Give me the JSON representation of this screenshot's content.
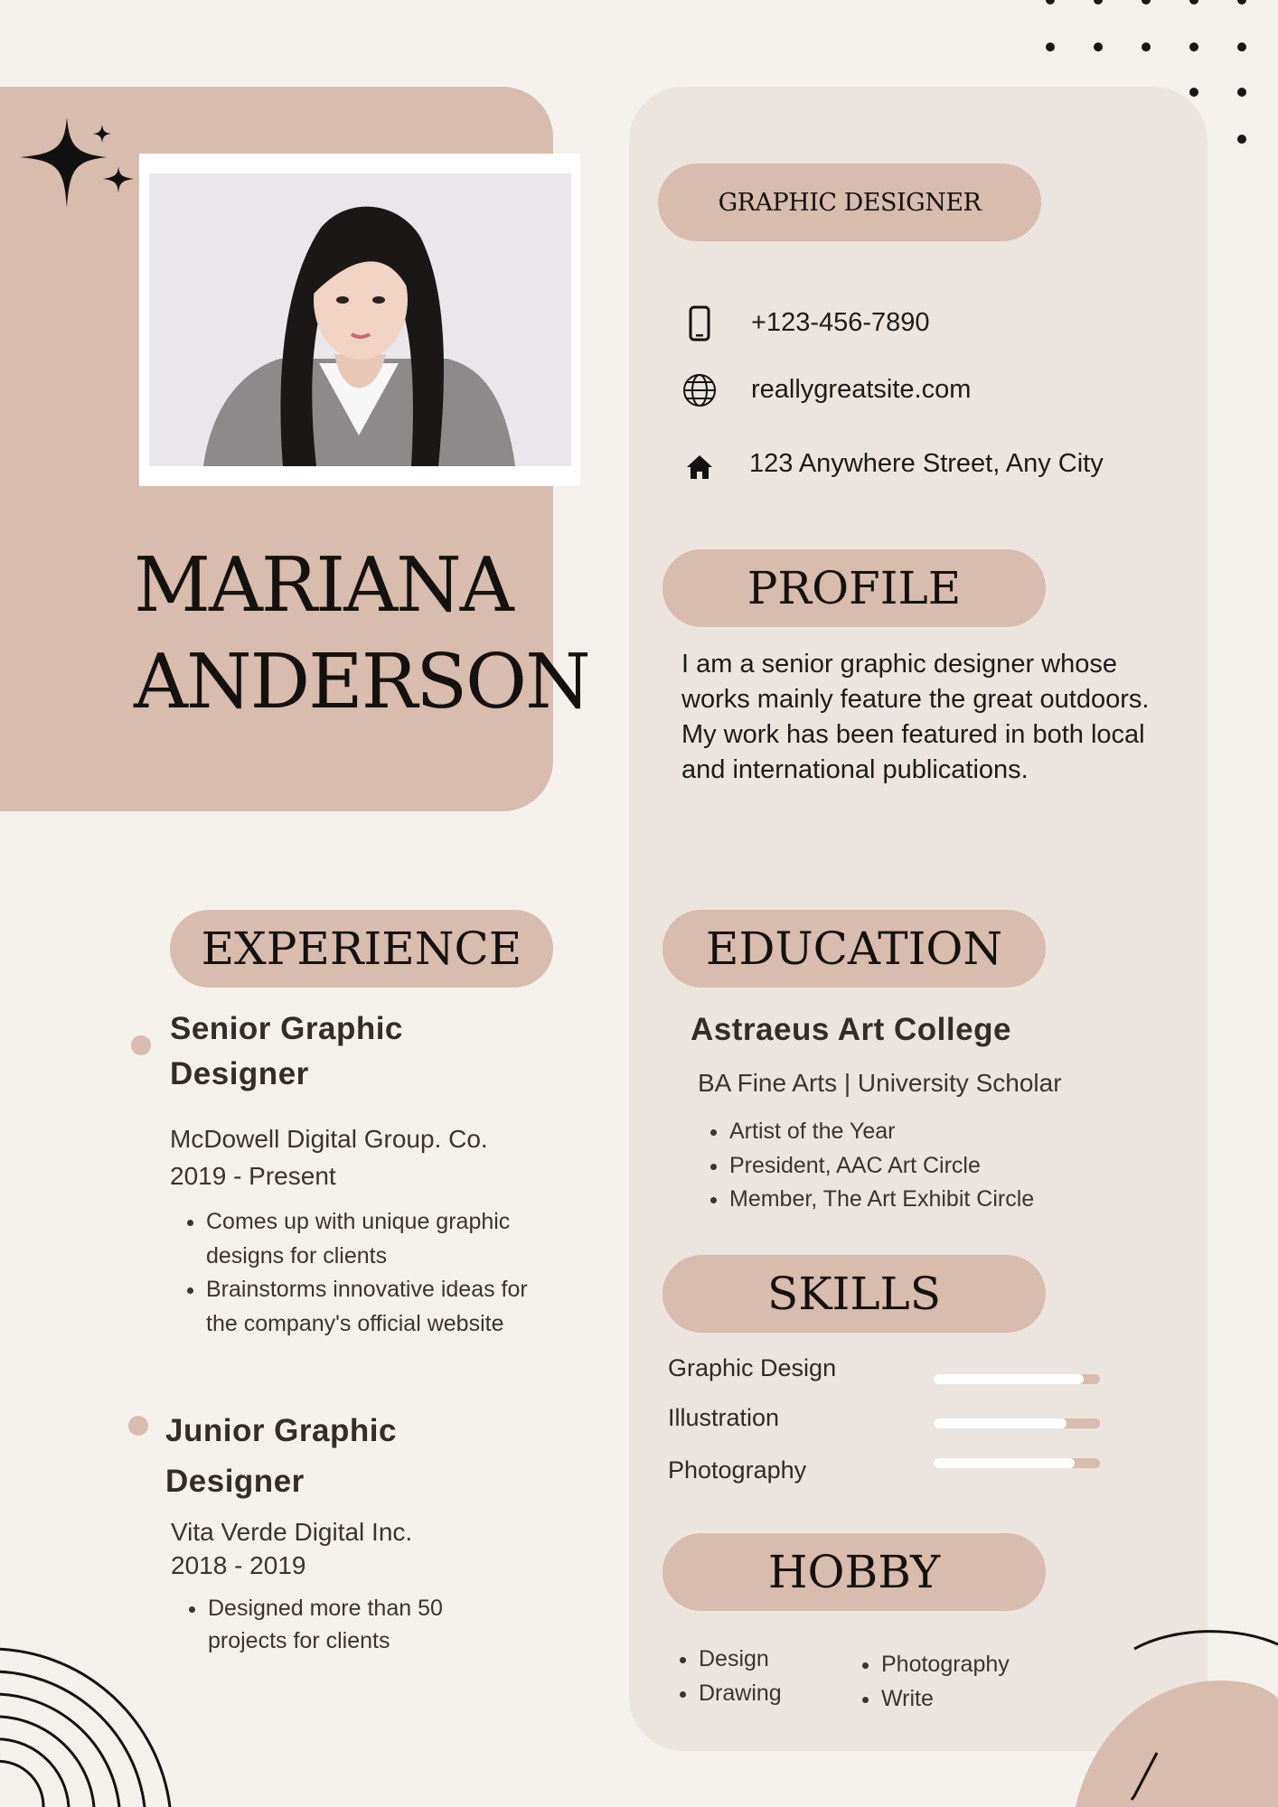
{
  "profile_header": {
    "first_name": "MARIANA",
    "last_name": "ANDERSON",
    "job_title": "GRAPHIC DESIGNER"
  },
  "contact": {
    "phone": "+123-456-7890",
    "website": "reallygreatsite.com",
    "address": "123 Anywhere Street, Any City"
  },
  "profile": {
    "heading": "PROFILE",
    "text": "I am a senior graphic designer whose works mainly feature the great outdoors. My work has been featured in both local and international publications."
  },
  "experience": {
    "heading": "EXPERIENCE",
    "jobs": [
      {
        "title": "Senior Graphic Designer",
        "company": "McDowell Digital Group. Co.",
        "period": "2019 - Present",
        "bullets": [
          "Comes up with unique graphic designs for clients",
          "Brainstorms innovative ideas for the company's official website"
        ]
      },
      {
        "title": "Junior Graphic Designer",
        "company": "Vita Verde Digital Inc.",
        "period": "2018 - 2019",
        "bullets": [
          "Designed more than 50 projects for clients"
        ]
      }
    ]
  },
  "education": {
    "heading": "EDUCATION",
    "school": "Astraeus Art College",
    "degree": "BA Fine Arts | University Scholar",
    "bullets": [
      "Artist of the Year",
      "President, AAC Art Circle",
      "Member, The Art Exhibit Circle"
    ]
  },
  "skills": {
    "heading": "SKILLS",
    "items": [
      {
        "name": "Graphic Design",
        "level": 0.9
      },
      {
        "name": "Illustration",
        "level": 0.8
      },
      {
        "name": "Photography",
        "level": 0.85
      }
    ]
  },
  "hobby": {
    "heading": "HOBBY",
    "col1": [
      "Design",
      "Drawing"
    ],
    "col2": [
      "Photography",
      "Write"
    ]
  },
  "icons": {
    "phone": "mobile-phone-icon",
    "website": "globe-icon",
    "address": "home-icon",
    "sparkle": "sparkle-icon"
  },
  "colors": {
    "background": "#f4f1ed",
    "accent": "#d8bcad",
    "panel": "#ebe4df",
    "text": "#1d1a18"
  }
}
